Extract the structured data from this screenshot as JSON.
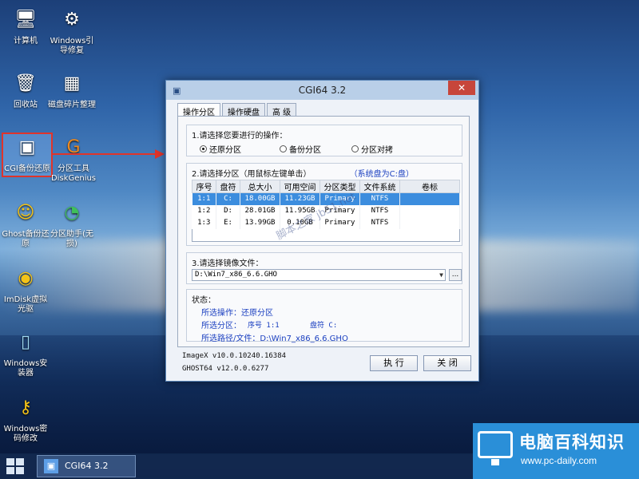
{
  "desktop": {
    "icons": [
      {
        "label": "计算机",
        "icon": "computer-icon"
      },
      {
        "label": "Windows引导修复",
        "icon": "gear-icon"
      },
      {
        "label": "回收站",
        "icon": "recycle-bin-icon"
      },
      {
        "label": "磁盘碎片整理",
        "icon": "defrag-icon"
      },
      {
        "label": "CGI备份还原",
        "icon": "cgi-icon"
      },
      {
        "label": "分区工具DiskGenius",
        "icon": "diskgenius-icon"
      },
      {
        "label": "Ghost备份还原",
        "icon": "ghost-icon"
      },
      {
        "label": "分区助手(无损)",
        "icon": "partition-assistant-icon"
      },
      {
        "label": "ImDisk虚拟光驱",
        "icon": "imdisk-icon"
      },
      {
        "label": "Windows安装器",
        "icon": "installer-icon"
      },
      {
        "label": "Windows密码修改",
        "icon": "key-icon"
      }
    ]
  },
  "window": {
    "title": "CGI64  3.2",
    "close_label": "✕",
    "tabs": [
      "操作分区",
      "操作硬盘",
      "高 级"
    ],
    "step1": {
      "label": "1.请选择您要进行的操作：",
      "options": [
        "还原分区",
        "备份分区",
        "分区对拷"
      ],
      "selected": "还原分区"
    },
    "step2": {
      "label": "2.请选择分区（用鼠标左键单击）",
      "hint": "（系统盘为C:盘）",
      "columns": [
        "序号",
        "盘符",
        "总大小",
        "可用空间",
        "分区类型",
        "文件系统",
        "卷标"
      ],
      "rows": [
        [
          "1:1",
          "C:",
          "18.00GB",
          "11.23GB",
          "Primary",
          "NTFS",
          ""
        ],
        [
          "1:2",
          "D:",
          "28.01GB",
          "11.95GB",
          "Primary",
          "NTFS",
          ""
        ],
        [
          "1:3",
          "E:",
          "13.99GB",
          "0.10GB",
          "Primary",
          "NTFS",
          ""
        ]
      ]
    },
    "step3": {
      "label": "3.请选择镜像文件：",
      "path": "D:\\Win7_x86_6.6.GHO",
      "browse_label": "..."
    },
    "status": {
      "label": "状态：",
      "operation": "所选操作：还原分区",
      "partition_prefix": "所选分区：",
      "partition_index": "序号 1:1",
      "partition_drive": "盘符 C:",
      "path": "所选路径/文件：D:\\Win7_x86_6.6.GHO"
    },
    "versions": [
      "ImageX v10.0.10240.16384",
      "GHOST64 v12.0.0.6277"
    ],
    "execute_label": "执 行",
    "close_button_label": "关 闭"
  },
  "watermark": "脚本之家 jb51.net",
  "taskbar": {
    "item_label": "CGI64  3.2"
  },
  "brand": {
    "name": "电脑百科知识",
    "url": "www.pc-daily.com"
  }
}
